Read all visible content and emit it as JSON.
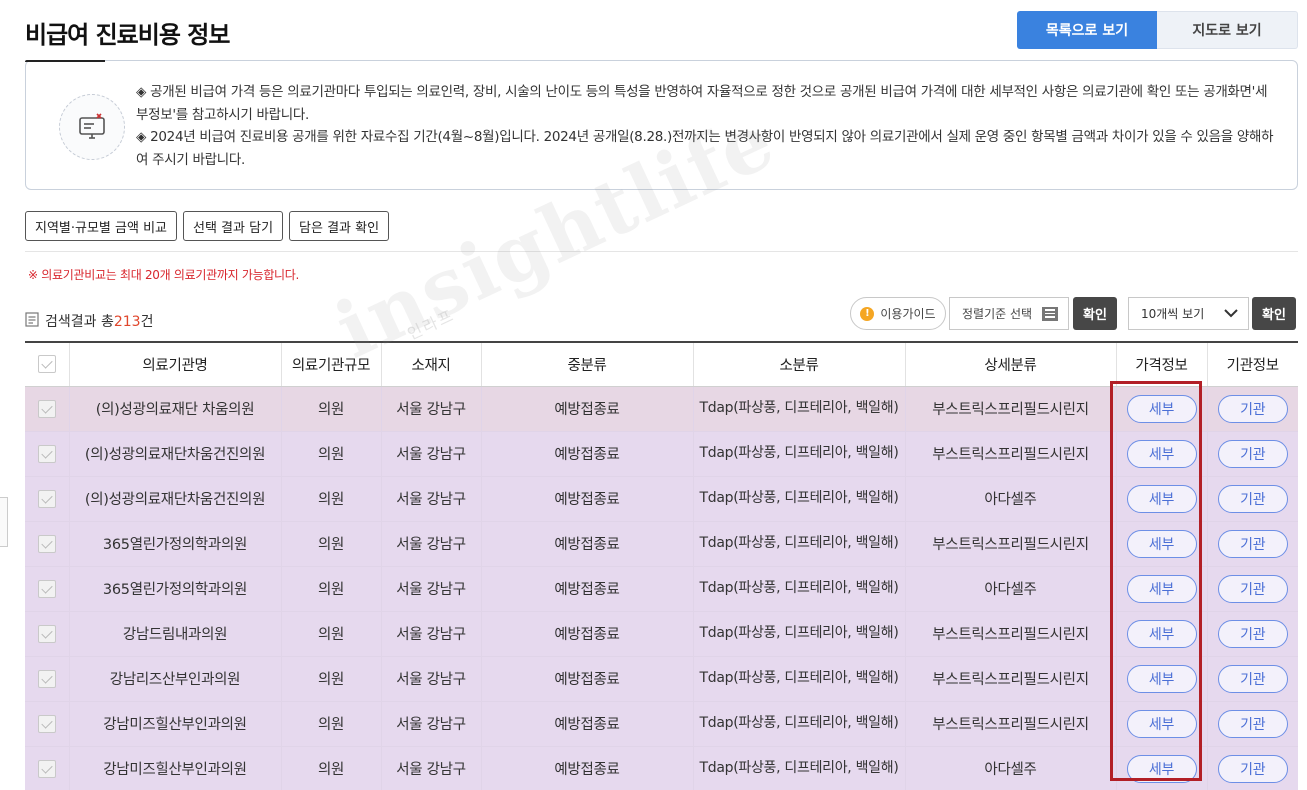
{
  "page": {
    "title": "비급여 진료비용 정보"
  },
  "view_toggle": {
    "list_label": "목록으로 보기",
    "map_label": "지도로 보기"
  },
  "notice": {
    "lines": [
      "◈ 공개된 비급여 가격 등은 의료기관마다 투입되는 의료인력, 장비, 시술의 난이도 등의 특성을 반영하여 자율적으로 정한 것으로 공개된 비급여 가격에 대한 세부적인 사항은 의료기관에 확인 또는 공개화면'세부정보'를 참고하시기 바랍니다.",
      "◈ 2024년 비급여 진료비용 공개를 위한 자료수집 기간(4월~8월)입니다. 2024년 공개일(8.28.)전까지는 변경사항이 반영되지 않아 의료기관에서 실제 운영 중인 항목별 금액과 차이가 있을 수 있음을 양해하여 주시기 바랍니다."
    ]
  },
  "actions": {
    "compare_label": "지역별·규모별 금액 비교",
    "select_label": "선택 결과 담기",
    "saved_label": "담은 결과 확인"
  },
  "warning": "※ 의료기관비교는 최대 20개 의료기관까지 가능합니다.",
  "results": {
    "prefix": "검색결과 총",
    "count": "213",
    "suffix": "건"
  },
  "toolbar": {
    "guide_label": "이용가이드",
    "guide_icon": "!",
    "sort_placeholder": "정렬기준 선택",
    "confirm_label": "확인",
    "per_page_label": "10개씩 보기",
    "confirm2_label": "확인"
  },
  "table": {
    "headers": [
      "의료기관명",
      "의료기관규모",
      "소재지",
      "중분류",
      "소분류",
      "상세분류",
      "가격정보",
      "기관정보"
    ],
    "detail_label": "세부",
    "org_label": "기관",
    "rows": [
      {
        "name": "(의)성광의료재단 차움의원",
        "size": "의원",
        "location": "서울 강남구",
        "mid": "예방접종료",
        "sub": "Tdap(파상풍, 디프테리아, 백일해)",
        "detail": "부스트릭스프리필드시린지"
      },
      {
        "name": "(의)성광의료재단차움건진의원",
        "size": "의원",
        "location": "서울 강남구",
        "mid": "예방접종료",
        "sub": "Tdap(파상풍, 디프테리아, 백일해)",
        "detail": "부스트릭스프리필드시린지"
      },
      {
        "name": "(의)성광의료재단차움건진의원",
        "size": "의원",
        "location": "서울 강남구",
        "mid": "예방접종료",
        "sub": "Tdap(파상풍, 디프테리아, 백일해)",
        "detail": "아다셀주"
      },
      {
        "name": "365열린가정의학과의원",
        "size": "의원",
        "location": "서울 강남구",
        "mid": "예방접종료",
        "sub": "Tdap(파상풍, 디프테리아, 백일해)",
        "detail": "부스트릭스프리필드시린지"
      },
      {
        "name": "365열린가정의학과의원",
        "size": "의원",
        "location": "서울 강남구",
        "mid": "예방접종료",
        "sub": "Tdap(파상풍, 디프테리아, 백일해)",
        "detail": "아다셀주"
      },
      {
        "name": "강남드림내과의원",
        "size": "의원",
        "location": "서울 강남구",
        "mid": "예방접종료",
        "sub": "Tdap(파상풍, 디프테리아, 백일해)",
        "detail": "부스트릭스프리필드시린지"
      },
      {
        "name": "강남리즈산부인과의원",
        "size": "의원",
        "location": "서울 강남구",
        "mid": "예방접종료",
        "sub": "Tdap(파상풍, 디프테리아, 백일해)",
        "detail": "부스트릭스프리필드시린지"
      },
      {
        "name": "강남미즈힐산부인과의원",
        "size": "의원",
        "location": "서울 강남구",
        "mid": "예방접종료",
        "sub": "Tdap(파상풍, 디프테리아, 백일해)",
        "detail": "부스트릭스프리필드시린지"
      },
      {
        "name": "강남미즈힐산부인과의원",
        "size": "의원",
        "location": "서울 강남구",
        "mid": "예방접종료",
        "sub": "Tdap(파상풍, 디프테리아, 백일해)",
        "detail": "아다셀주"
      }
    ]
  },
  "watermark": {
    "text": "insightlife",
    "sub": "인라프"
  },
  "colors": {
    "accent": "#3a82df",
    "row_highlight": "#e6d9ee",
    "warning": "#d8262d",
    "highlight_box": "#b21f26"
  },
  "icons": {
    "notice_icon": "computer-payment-icon",
    "result_icon": "list-document-icon",
    "dropdown_icon": "chevron-down-icon"
  }
}
